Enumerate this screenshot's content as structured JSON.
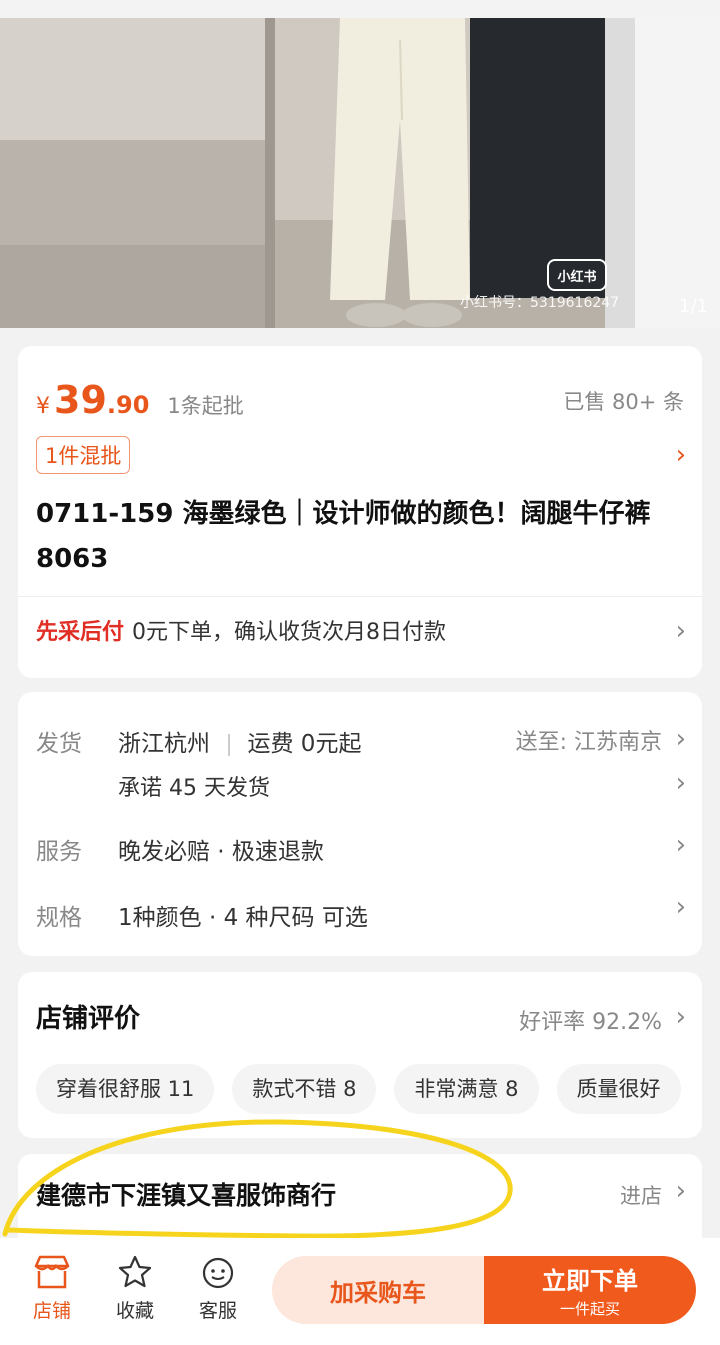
{
  "hero": {
    "watermark_logo": "小红书",
    "watermark_id": "小红书号：5319616247",
    "counter": "1/1"
  },
  "price": {
    "currency": "¥",
    "integer": "39",
    "decimal": ".90",
    "moq": "1条起批",
    "sold": "已售 80+ 条",
    "mix_tag": "1件混批"
  },
  "product": {
    "title": "0711-159 海墨绿色｜设计师做的颜色！阔腿牛仔裤8063"
  },
  "payment": {
    "highlight": "先采后付",
    "text": "0元下单，确认收货次月8日付款"
  },
  "shipping": {
    "label": "发货",
    "origin": "浙江杭州",
    "freight": "运费 0元起",
    "ship_to": "送至: 江苏南京",
    "promise": "承诺 45 天发货",
    "service_label": "服务",
    "service_value": "晚发必赔 · 极速退款",
    "spec_label": "规格",
    "spec_value": "1种颜色 · 4 种尺码 可选"
  },
  "reviews": {
    "title": "店铺评价",
    "good_rate": "好评率 92.2%",
    "tags": [
      "穿着很舒服 11",
      "款式不错 8",
      "非常满意 8",
      "质量很好"
    ]
  },
  "store": {
    "name": "建德市下涯镇又喜服饰商行",
    "enter": "进店"
  },
  "bottom_bar": {
    "shop": "店铺",
    "favorite": "收藏",
    "service": "客服",
    "add_cart": "加采购车",
    "buy_now": "立即下单",
    "buy_now_sub": "一件起买"
  },
  "colors": {
    "accent": "#e8561c",
    "red": "#e02e24",
    "highlight_circle": "#f6d41e"
  },
  "icons": [
    "chevron-right-icon",
    "store-icon",
    "star-icon",
    "service-face-icon"
  ]
}
